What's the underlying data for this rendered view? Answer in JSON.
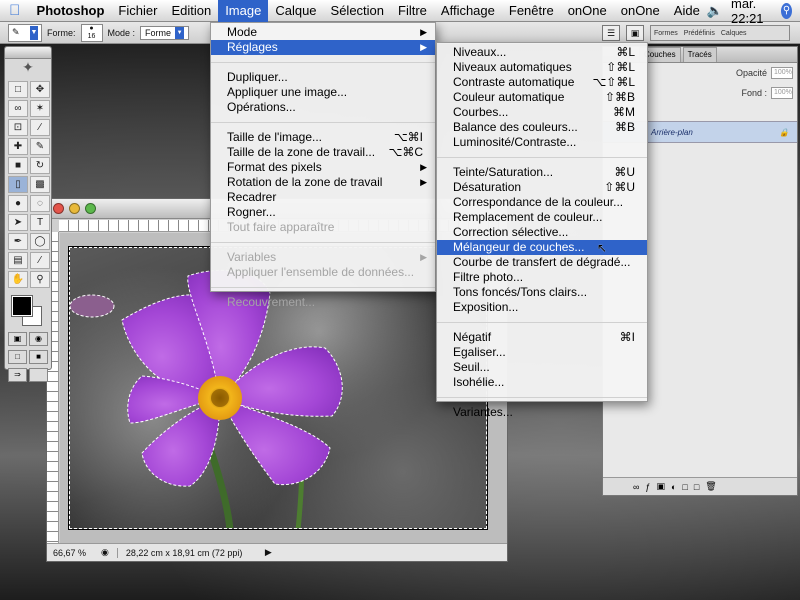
{
  "menubar": {
    "app": "Photoshop",
    "items": [
      "Fichier",
      "Edition",
      "Image",
      "Calque",
      "Sélection",
      "Filtre",
      "Affichage",
      "Fenêtre",
      "onOne",
      "onOne",
      "Aide"
    ],
    "clock": "mar. 22:21",
    "volume_icon": "speaker-icon",
    "spotlight_icon": "spotlight-icon"
  },
  "options": {
    "forme_label": "Forme:",
    "brush_size": "16",
    "mode_label": "Mode :",
    "mode_value": "Forme",
    "palette_tabs": [
      "Formes",
      "Prédéfinis",
      "Calques"
    ]
  },
  "image_menu": {
    "items": [
      {
        "label": "Mode",
        "shortcut": "",
        "submenu": true,
        "disabled": false
      },
      {
        "label": "Réglages",
        "shortcut": "",
        "submenu": true,
        "disabled": false,
        "highlight": true
      },
      {
        "sep": true
      },
      {
        "label": "Dupliquer...",
        "shortcut": ""
      },
      {
        "label": "Appliquer une image...",
        "shortcut": ""
      },
      {
        "label": "Opérations...",
        "shortcut": ""
      },
      {
        "sep": true
      },
      {
        "label": "Taille de l'image...",
        "shortcut": "⌥⌘I"
      },
      {
        "label": "Taille de la zone de travail...",
        "shortcut": "⌥⌘C"
      },
      {
        "label": "Format des pixels",
        "shortcut": "",
        "submenu": true
      },
      {
        "label": "Rotation de la zone de travail",
        "shortcut": "",
        "submenu": true
      },
      {
        "label": "Recadrer",
        "shortcut": ""
      },
      {
        "label": "Rogner...",
        "shortcut": ""
      },
      {
        "label": "Tout faire apparaître",
        "shortcut": "",
        "disabled": true
      },
      {
        "sep": true
      },
      {
        "label": "Variables",
        "shortcut": "",
        "submenu": true,
        "disabled": true
      },
      {
        "label": "Appliquer l'ensemble de données...",
        "shortcut": "",
        "disabled": true
      },
      {
        "sep": true
      },
      {
        "label": "Recouvrement...",
        "shortcut": "",
        "disabled": true
      }
    ]
  },
  "reglages_menu": {
    "items": [
      {
        "label": "Niveaux...",
        "shortcut": "⌘L"
      },
      {
        "label": "Niveaux automatiques",
        "shortcut": "⇧⌘L"
      },
      {
        "label": "Contraste automatique",
        "shortcut": "⌥⇧⌘L"
      },
      {
        "label": "Couleur automatique",
        "shortcut": "⇧⌘B"
      },
      {
        "label": "Courbes...",
        "shortcut": "⌘M"
      },
      {
        "label": "Balance des couleurs...",
        "shortcut": "⌘B"
      },
      {
        "label": "Luminosité/Contraste...",
        "shortcut": ""
      },
      {
        "sep": true
      },
      {
        "label": "Teinte/Saturation...",
        "shortcut": "⌘U"
      },
      {
        "label": "Désaturation",
        "shortcut": "⇧⌘U"
      },
      {
        "label": "Correspondance de la couleur...",
        "shortcut": ""
      },
      {
        "label": "Remplacement de couleur...",
        "shortcut": ""
      },
      {
        "label": "Correction sélective...",
        "shortcut": ""
      },
      {
        "label": "Mélangeur de couches...",
        "shortcut": "",
        "highlight": true
      },
      {
        "label": "Courbe de transfert de dégradé...",
        "shortcut": ""
      },
      {
        "label": "Filtre photo...",
        "shortcut": ""
      },
      {
        "label": "Tons foncés/Tons clairs...",
        "shortcut": ""
      },
      {
        "label": "Exposition...",
        "shortcut": ""
      },
      {
        "sep": true
      },
      {
        "label": "Négatif",
        "shortcut": "⌘I"
      },
      {
        "label": "Egaliser...",
        "shortcut": ""
      },
      {
        "label": "Seuil...",
        "shortcut": ""
      },
      {
        "label": "Isohélie...",
        "shortcut": ""
      },
      {
        "sep": true
      },
      {
        "label": "Variantes...",
        "shortcut": ""
      }
    ]
  },
  "document": {
    "zoom": "66,67 %",
    "info": "28,22 cm x 18,91 cm (72 ppi)"
  },
  "layers": {
    "tabs": [
      "Couches",
      "Tracés"
    ],
    "opacity_label": "Opacité",
    "opacity_value": "100%",
    "fill_label": "Fond :",
    "fill_value": "100%",
    "layer_name": "Arrière-plan"
  },
  "colors": {
    "accent": "#2f63c9",
    "flower_petal": "#a447d6",
    "flower_center": "#f2b51a"
  }
}
